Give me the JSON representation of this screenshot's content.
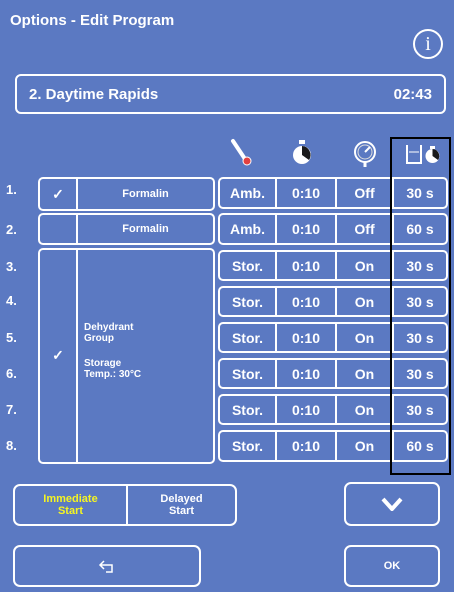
{
  "header": {
    "title": "Options - Edit Program",
    "info_glyph": "i"
  },
  "program": {
    "name": "2. Daytime Rapids",
    "duration": "02:43"
  },
  "column_icons": [
    "thermometer-icon",
    "stopwatch-icon",
    "pressure-gauge-icon",
    "drip-timer-icon"
  ],
  "steps": [
    {
      "num": "1.",
      "check": "✓",
      "reagent": "Formalin",
      "temp": "Amb.",
      "time": "0:10",
      "pv": "Off",
      "drip": "30 s"
    },
    {
      "num": "2.",
      "check": "",
      "reagent": "Formalin",
      "temp": "Amb.",
      "time": "0:10",
      "pv": "Off",
      "drip": "60 s"
    },
    {
      "num": "3.",
      "temp": "Stor.",
      "time": "0:10",
      "pv": "On",
      "drip": "30 s"
    },
    {
      "num": "4.",
      "temp": "Stor.",
      "time": "0:10",
      "pv": "On",
      "drip": "30 s"
    },
    {
      "num": "5.",
      "temp": "Stor.",
      "time": "0:10",
      "pv": "On",
      "drip": "30 s"
    },
    {
      "num": "6.",
      "temp": "Stor.",
      "time": "0:10",
      "pv": "On",
      "drip": "30 s"
    },
    {
      "num": "7.",
      "temp": "Stor.",
      "time": "0:10",
      "pv": "On",
      "drip": "30 s"
    },
    {
      "num": "8.",
      "temp": "Stor.",
      "time": "0:10",
      "pv": "On",
      "drip": "60 s"
    }
  ],
  "group": {
    "check": "✓",
    "name_line1": "Dehydrant",
    "name_line2": "Group",
    "storage_line1": "Storage",
    "storage_line2": "Temp.: 30°C"
  },
  "start": {
    "immediate_line1": "Immediate",
    "immediate_line2": "Start",
    "delayed_line1": "Delayed",
    "delayed_line2": "Start",
    "active_color": "#f5f522"
  },
  "nav": {
    "down_glyph": "V",
    "back_glyph": "⮌",
    "ok_label": "OK"
  },
  "colors": {
    "background": "#5b79c2",
    "border": "#ffffff",
    "highlight_frame": "#000000"
  }
}
